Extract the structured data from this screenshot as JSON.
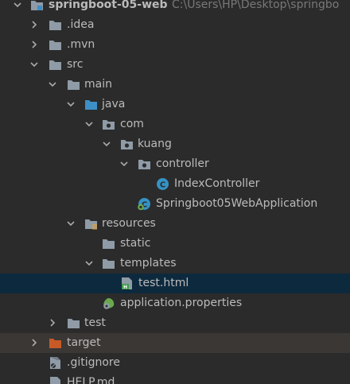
{
  "colors": {
    "background": "#2b2b2b",
    "selected_row": "#0d293e",
    "excluded_row": "#3b3734",
    "text": "#bbbbbb",
    "path_text": "#787878",
    "folder_grey": "#8f9ba6",
    "source_folder_blue": "#3d8fc7",
    "excluded_folder_orange": "#c85a28",
    "class_icon": "#3592c4",
    "spring_green": "#6aa84f"
  },
  "project_tree": {
    "root": {
      "name": "springboot-05-web",
      "path": "C:\\Users\\HP\\Desktop\\springbo",
      "icon": "module-folder-icon"
    },
    "items": [
      {
        "label": "idea",
        "prefix": ".",
        "icon": "folder-icon"
      },
      {
        "label": ".idea",
        "icon": "folder-icon"
      },
      {
        "label": ".mvn",
        "icon": "folder-icon"
      },
      {
        "label": "src",
        "icon": "folder-icon"
      },
      {
        "label": "main",
        "icon": "folder-icon"
      },
      {
        "label": "java",
        "icon": "source-folder-icon"
      },
      {
        "label": "com",
        "icon": "package-icon"
      },
      {
        "label": "kuang",
        "icon": "package-icon"
      },
      {
        "label": "controller",
        "icon": "package-icon"
      },
      {
        "label": "IndexController",
        "icon": "class-icon"
      },
      {
        "label": "Springboot05WebApplication",
        "icon": "spring-boot-class-icon"
      },
      {
        "label": "resources",
        "icon": "resources-folder-icon"
      },
      {
        "label": "static",
        "icon": "folder-icon"
      },
      {
        "label": "templates",
        "icon": "folder-icon"
      },
      {
        "label": "test.html",
        "icon": "html-file-icon"
      },
      {
        "label": "application.properties",
        "icon": "spring-properties-icon"
      },
      {
        "label": "test",
        "icon": "folder-icon"
      },
      {
        "label": "target",
        "icon": "excluded-folder-icon"
      },
      {
        "label": ".gitignore",
        "icon": "gitignore-file-icon"
      },
      {
        "label": "HELP.md",
        "icon": "markdown-file-icon"
      }
    ]
  }
}
